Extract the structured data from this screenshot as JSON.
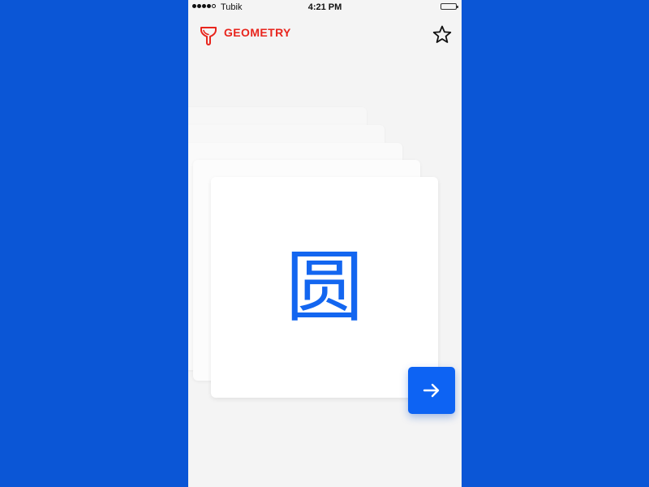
{
  "status_bar": {
    "carrier": "Tubik",
    "time": "4:21 PM",
    "signal_bars_filled": 4,
    "signal_bars_total": 5
  },
  "header": {
    "title": "GEOMETRY",
    "logo_icon": "funnel-icon",
    "favorite_icon": "star-icon"
  },
  "card": {
    "character": "圆"
  },
  "next_button": {
    "icon": "arrow-right-icon"
  },
  "colors": {
    "background": "#0b56d6",
    "screen": "#f4f4f4",
    "brand": "#e8251d",
    "accent": "#0d63f3",
    "glyph": "#1366f0"
  }
}
